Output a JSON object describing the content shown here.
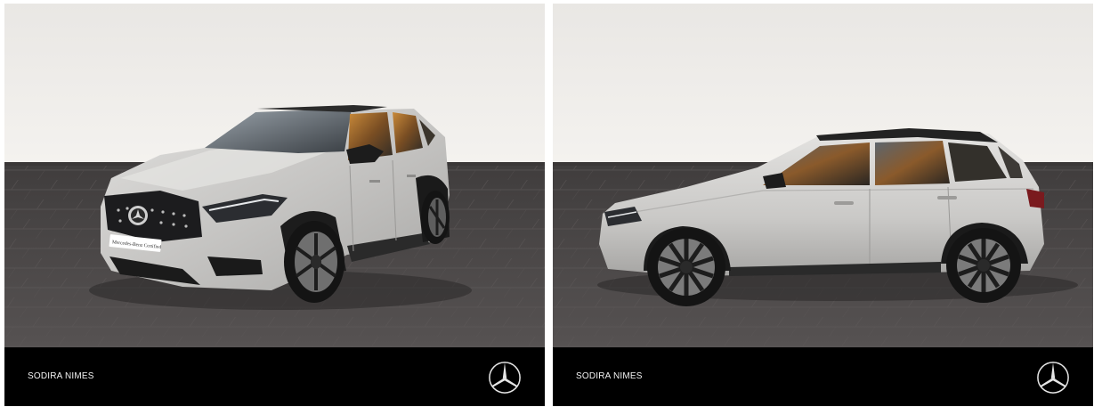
{
  "photos": [
    {
      "view": "front three-quarter",
      "dealer": "SODIRA NIMES",
      "plate_text": "Mercedes-Benz Certified",
      "logo_icon": "mercedes-star-icon"
    },
    {
      "view": "side profile",
      "dealer": "SODIRA NIMES",
      "logo_icon": "mercedes-star-icon"
    }
  ],
  "colors": {
    "footer": "#000000",
    "footer_text": "#f2f2f2",
    "wall": "#f1efec",
    "floor": "#4b4848",
    "car_body": "#c9c8c6"
  }
}
